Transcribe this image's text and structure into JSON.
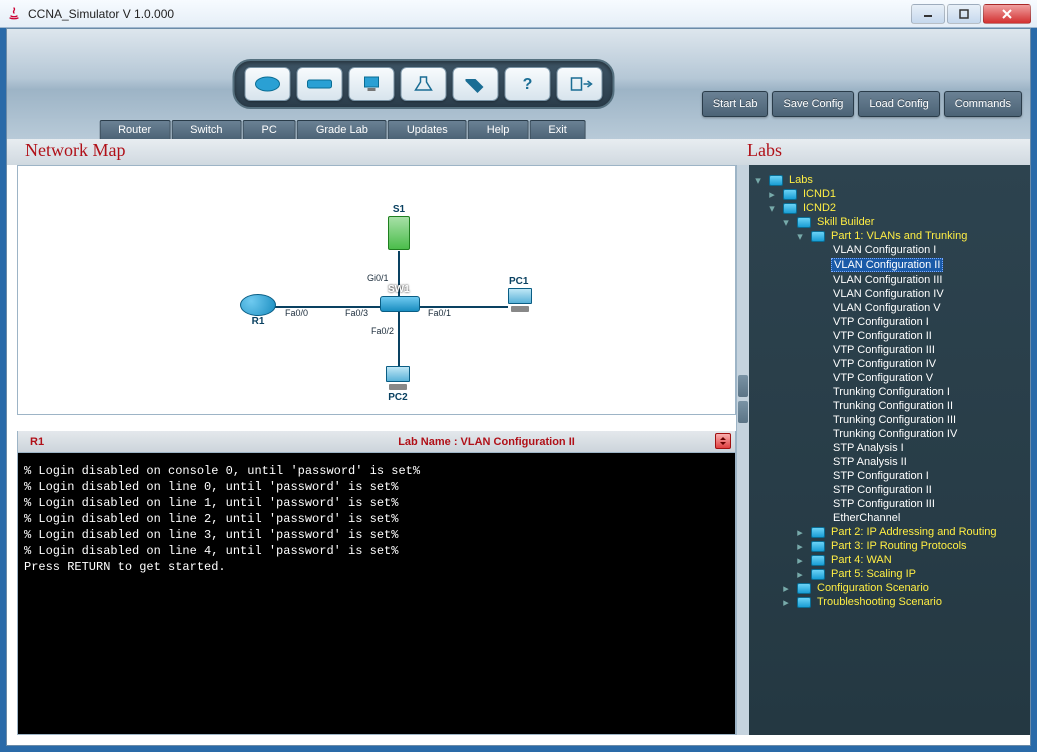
{
  "window": {
    "title": "CCNA_Simulator V 1.0.000"
  },
  "dock": {
    "router": "Router",
    "switch": "Switch",
    "pc": "PC",
    "grade": "Grade Lab",
    "updates": "Updates",
    "help": "Help",
    "exit": "Exit"
  },
  "top_right": {
    "start_lab": "Start Lab",
    "save_config": "Save Config",
    "load_config": "Load Config",
    "commands": "Commands"
  },
  "titles": {
    "left": "Network Map",
    "right": "Labs"
  },
  "map": {
    "devices": {
      "r1": "R1",
      "sw1": "SW1",
      "s1": "S1",
      "pc1": "PC1",
      "pc2": "PC2"
    },
    "ports": {
      "fa00": "Fa0/0",
      "fa03": "Fa0/3",
      "gi01": "Gi0/1",
      "fa01": "Fa0/1",
      "fa02": "Fa0/2"
    }
  },
  "term_header": {
    "device": "R1",
    "lab_label_prefix": "Lab Name :  ",
    "lab_name": "VLAN Configuration II"
  },
  "terminal_lines": [
    "% Login disabled on console 0, until 'password' is set%",
    "% Login disabled on line 0, until 'password' is set%",
    "% Login disabled on line 1, until 'password' is set%",
    "% Login disabled on line 2, until 'password' is set%",
    "% Login disabled on line 3, until 'password' is set%",
    "% Login disabled on line 4, until 'password' is set%",
    "Press RETURN to get started."
  ],
  "tree": {
    "root": "Labs",
    "icnd1": "ICND1",
    "icnd2": "ICND2",
    "skill_builder": "Skill Builder",
    "part1": "Part 1: VLANs and Trunking",
    "leaves1": [
      "VLAN Configuration I",
      "VLAN Configuration II",
      "VLAN Configuration III",
      "VLAN Configuration IV",
      "VLAN Configuration V",
      "VTP Configuration I",
      "VTP Configuration II",
      "VTP Configuration III",
      "VTP Configuration IV",
      "VTP Configuration V",
      "Trunking Configuration I",
      "Trunking Configuration II",
      "Trunking Configuration III",
      "Trunking Configuration IV",
      "STP Analysis I",
      "STP Analysis II",
      "STP Configuration I",
      "STP Configuration II",
      "STP Configuration III",
      "EtherChannel"
    ],
    "part2": "Part 2: IP Addressing and Routing",
    "part3": "Part 3: IP Routing Protocols",
    "part4": "Part 4: WAN",
    "part5": "Part 5: Scaling IP",
    "config_scenario": "Configuration Scenario",
    "trouble_scenario": "Troubleshooting Scenario"
  }
}
